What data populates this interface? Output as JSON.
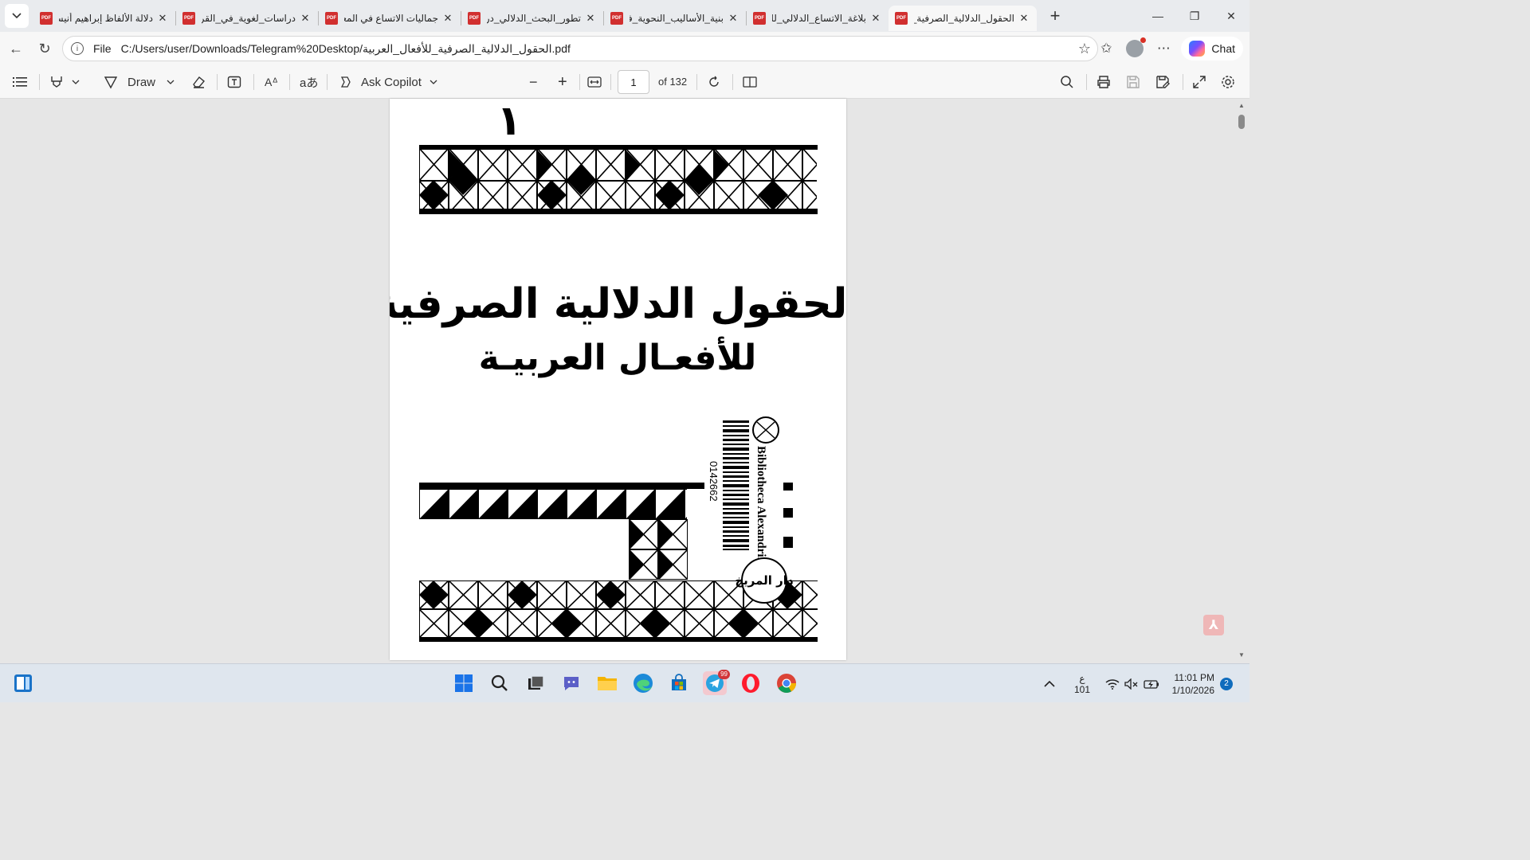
{
  "browser": {
    "tabs": [
      {
        "title": "الحقول_الدلالية_الصرفية_ل",
        "active": true
      },
      {
        "title": "بلاغة_الاتساع_الدلالي_للمد",
        "active": false
      },
      {
        "title": "بنية_الأساليب_النحوية_في",
        "active": false
      },
      {
        "title": "تطور_البحث_الدلالي_دراسة",
        "active": false
      },
      {
        "title": "جماليات الاتساع في المعنى",
        "active": false
      },
      {
        "title": "دراسات_لغوية_في_القرآن",
        "active": false
      },
      {
        "title": "دلالة الألفاظ إبراهيم أنيس",
        "active": false
      }
    ],
    "address": {
      "protocol_label": "File",
      "url": "C:/Users/user/Downloads/Telegram%20Desktop/الحقول_الدلالية_الصرفية_للأفعال_العربية.pdf"
    },
    "chat_label": "Chat"
  },
  "pdf_toolbar": {
    "draw_label": "Draw",
    "ask_copilot_label": "Ask Copilot",
    "page_number": "1",
    "page_total_label": "of 132"
  },
  "document": {
    "volume_number": "١",
    "title_line1": "الحقول الدلالية الصرفية",
    "title_line2": "للأفعـال العربيـة",
    "library_label": "Bibliotheca Alexandrina",
    "barcode_number": "0142662",
    "publisher_logo_text": "دار المريخ"
  },
  "taskbar": {
    "telegram_badge": "99",
    "lang_top": "ع",
    "lang_bottom": "101",
    "time": "11:01 PM",
    "date": "1/10/2026",
    "notification_count": "2"
  }
}
